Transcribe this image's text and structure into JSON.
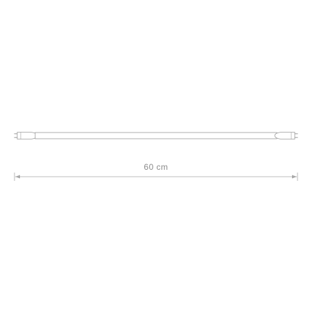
{
  "dimension": {
    "length_label": "60 cm"
  },
  "colors": {
    "outline": "#9a9a9a",
    "dimension_line": "#a8a8a8",
    "tube_fill": "#ffffff"
  }
}
